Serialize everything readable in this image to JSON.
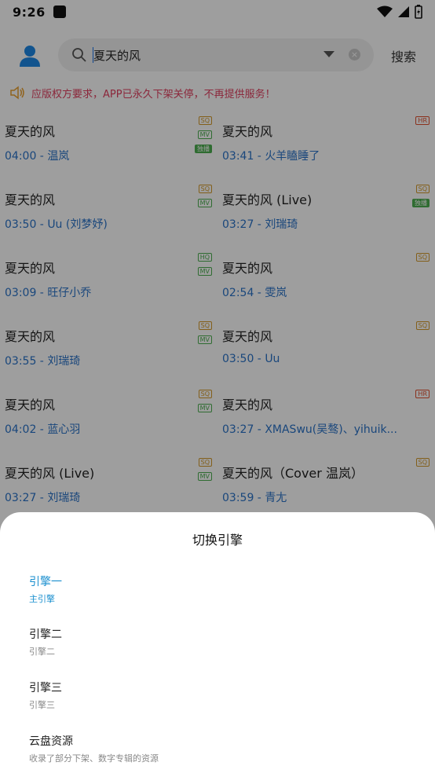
{
  "status": {
    "time": "9:26"
  },
  "search": {
    "query": "夏天的风",
    "button": "搜索"
  },
  "notice": "应版权方要求，APP已永久下架关停，不再提供服务！",
  "songs": [
    {
      "title": "夏天的风",
      "time": "03:41",
      "artist": "火羊瞌睡了",
      "badges": [
        "HR"
      ]
    },
    {
      "title": "夏天的风",
      "time": "04:00",
      "artist": "温岚",
      "badges": [
        "SQ",
        "MV",
        "独播"
      ]
    },
    {
      "title": "夏天的风",
      "time": "03:50",
      "artist": "Uu (刘梦妤)",
      "badges": [
        "SQ",
        "MV"
      ]
    },
    {
      "title": "夏天的风 (Live)",
      "time": "03:27",
      "artist": "刘瑞琦",
      "badges": [
        "SQ",
        "独播"
      ]
    },
    {
      "title": "夏天的风",
      "time": "03:09",
      "artist": "旺仔小乔",
      "badges": [
        "HQ",
        "MV"
      ]
    },
    {
      "title": "夏天的风",
      "time": "02:54",
      "artist": "雯岚",
      "badges": [
        "SQ"
      ]
    },
    {
      "title": "夏天的风",
      "time": "03:55",
      "artist": "刘瑞琦",
      "badges": [
        "SQ",
        "MV"
      ]
    },
    {
      "title": "夏天的风",
      "time": "03:50",
      "artist": "Uu",
      "badges": [
        "SQ"
      ]
    },
    {
      "title": "夏天的风",
      "time": "04:02",
      "artist": "蓝心羽",
      "badges": [
        "SQ",
        "MV"
      ]
    },
    {
      "title": "夏天的风",
      "time": "03:27",
      "artist": "XMASwu(吴骜)、yihuik...",
      "badges": [
        "HR"
      ]
    },
    {
      "title": "夏天的风 (Live)",
      "time": "03:27",
      "artist": "刘瑞琦",
      "badges": [
        "SQ",
        "MV"
      ]
    },
    {
      "title": "夏天的风（Cover 温岚）",
      "time": "03:59",
      "artist": "青尢",
      "badges": [
        "SQ"
      ]
    }
  ],
  "sheet": {
    "title": "切换引擎",
    "engines": [
      {
        "name": "引擎一",
        "sub": "主引擎",
        "active": true
      },
      {
        "name": "引擎二",
        "sub": "引擎二",
        "active": false
      },
      {
        "name": "引擎三",
        "sub": "引擎三",
        "active": false
      },
      {
        "name": "云盘资源",
        "sub": "收录了部分下架、数字专辑的资源",
        "active": false
      }
    ]
  }
}
